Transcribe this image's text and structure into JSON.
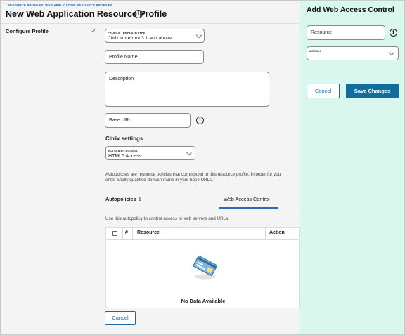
{
  "breadcrumb": "/ RESOURCE PROFILES/ WEB APPLICATION RESOURCE PROFILES",
  "page_title": "New Web Application Resource Profile",
  "sidebar": {
    "items": [
      {
        "label": "Configure Profile"
      }
    ]
  },
  "form": {
    "profile_template": {
      "label": "PROFILE TEMPLATE/TYPE",
      "value": "Citrix storefront 3.1 and above"
    },
    "profile_name": {
      "placeholder": "Profile Name"
    },
    "description": {
      "placeholder": "Description"
    },
    "base_url": {
      "placeholder": "Base URL"
    },
    "citrix_settings": {
      "heading": "Citrix settings",
      "ica_label": "ICA CLIENT ACCESS",
      "ica_value": "HTML5 Access"
    },
    "autopolicy_note_line1": "Autopolicies are resource policies that correspond to this resource profile. In order for you",
    "autopolicy_note_line2": "enter a fully qualified domain name in your base URLs."
  },
  "tabs": [
    {
      "label": "Autopolicies",
      "count": "1"
    },
    {
      "label": "Web Access Control",
      "active": true
    }
  ],
  "tab_description": "Use this autopolicy to control access to web servers and URLs.",
  "table": {
    "columns": [
      "#",
      "Resource",
      "Action"
    ],
    "empty_text": "No Data Available"
  },
  "cancel_label": "Cancel",
  "panel": {
    "title": "Add Web Access Control",
    "resource_placeholder": "Resource",
    "action_label": "ACTION",
    "cancel_label": "Cancel",
    "save_label": "Save Changes"
  },
  "colors": {
    "accent": "#116d9e",
    "panel_bg": "#d9f7ec",
    "link": "#2a6db0"
  },
  "icons": [
    "info-icon",
    "chevron-right-icon",
    "chevron-down-icon",
    "empty-data-illustration-icon"
  ]
}
